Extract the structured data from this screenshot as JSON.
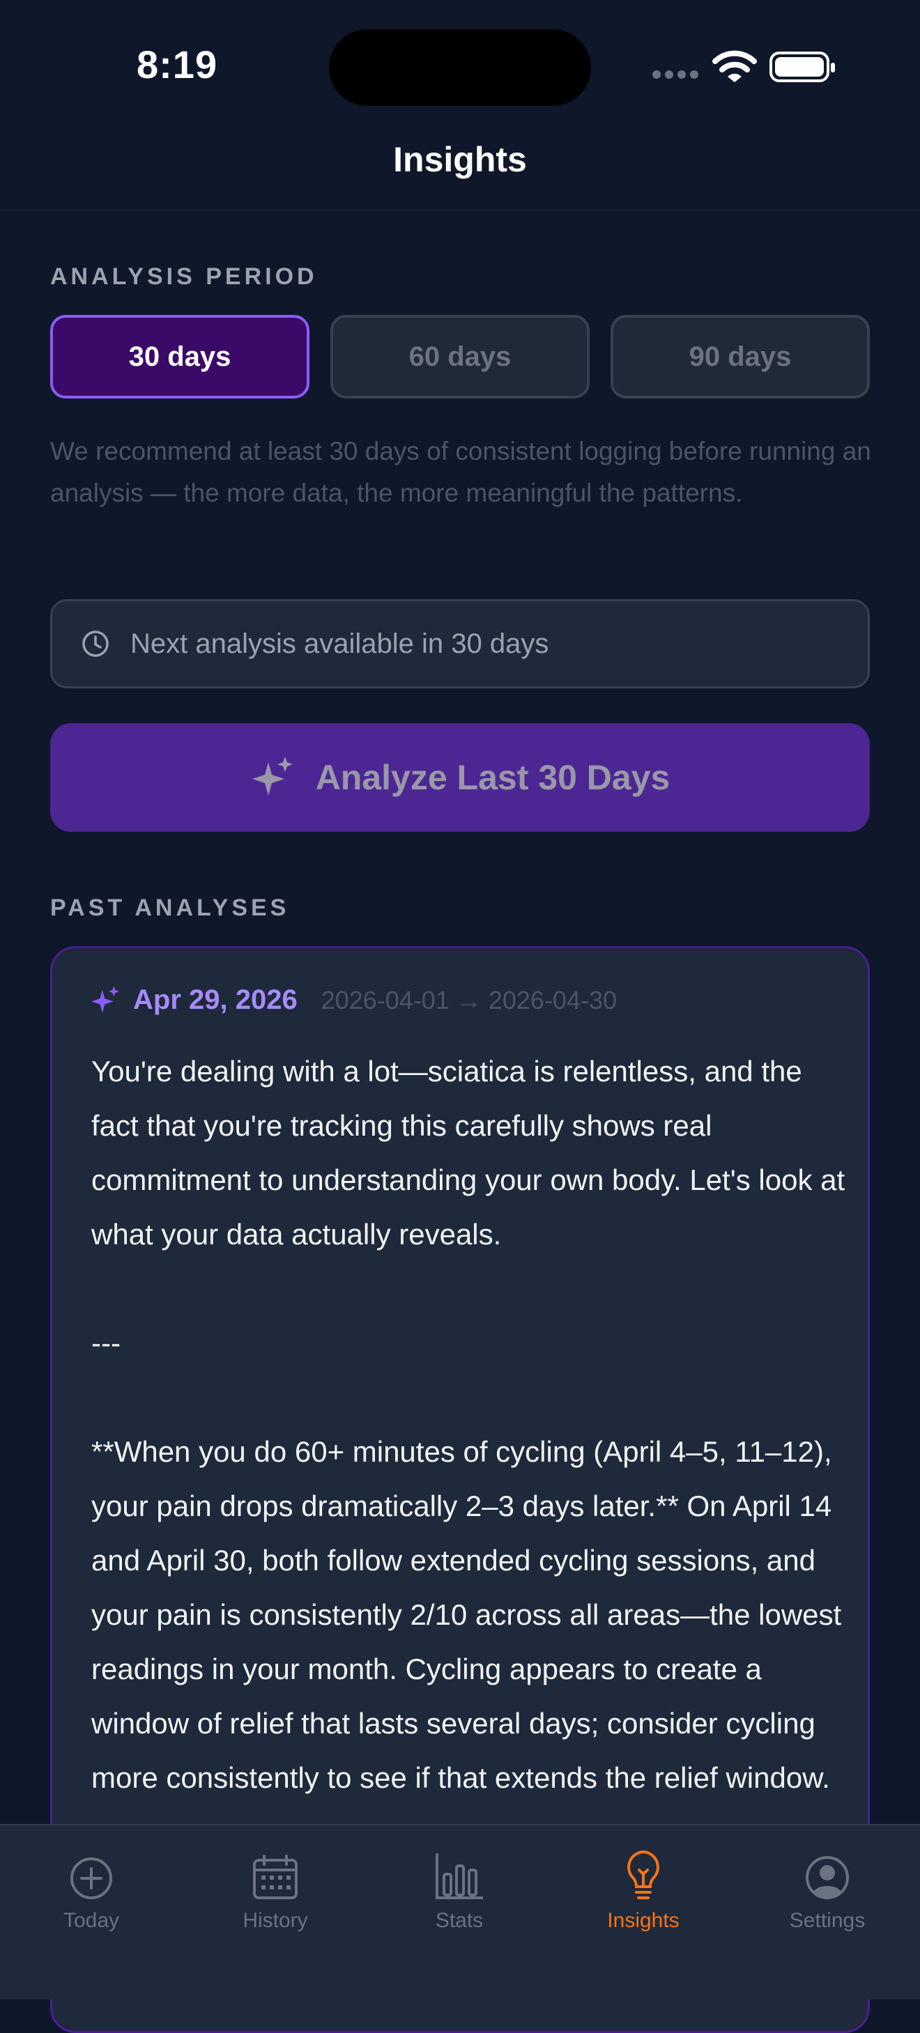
{
  "status": {
    "time": "8:19"
  },
  "nav": {
    "title": "Insights"
  },
  "analysis_period": {
    "label": "ANALYSIS PERIOD",
    "options": [
      "30 days",
      "60 days",
      "90 days"
    ],
    "selected": "30 days",
    "recommendation": "We recommend at least 30 days of consistent logging before running an analysis — the more data, the more meaningful the patterns."
  },
  "next_analysis": {
    "text": "Next analysis available in 30 days",
    "icon": "clock-icon"
  },
  "analyze_button": {
    "label": "Analyze Last 30 Days",
    "icon": "sparkles-icon"
  },
  "past_analyses": {
    "label": "PAST ANALYSES",
    "items": [
      {
        "date": "Apr 29, 2026",
        "range": "2026-04-01 → 2026-04-30",
        "body": "You're dealing with a lot—sciatica is relentless, and the fact that you're tracking this carefully shows real commitment to understanding your own body. Let's look at what your data actually reveals.\n\n---\n\n**When you do 60+ minutes of cycling (April 4–5, 11–12), your pain drops dramatically 2–3 days later.** On April 14 and April 30, both follow extended cycling sessions, and your pain is consistently 2/10 across all areas—the lowest readings in your month. Cycling appears to create a window of relief that lasts several days; consider cycling more consistently to see if that extends the relief window."
      }
    ]
  },
  "tabs": [
    {
      "label": "Today",
      "icon": "plus-circle-icon"
    },
    {
      "label": "History",
      "icon": "calendar-icon"
    },
    {
      "label": "Stats",
      "icon": "bar-chart-icon"
    },
    {
      "label": "Insights",
      "icon": "lightbulb-icon",
      "active": true
    },
    {
      "label": "Settings",
      "icon": "user-circle-icon"
    }
  ],
  "colors": {
    "accent": "#8b5cf6",
    "active_tab": "#f97316",
    "background": "#0f172a"
  }
}
